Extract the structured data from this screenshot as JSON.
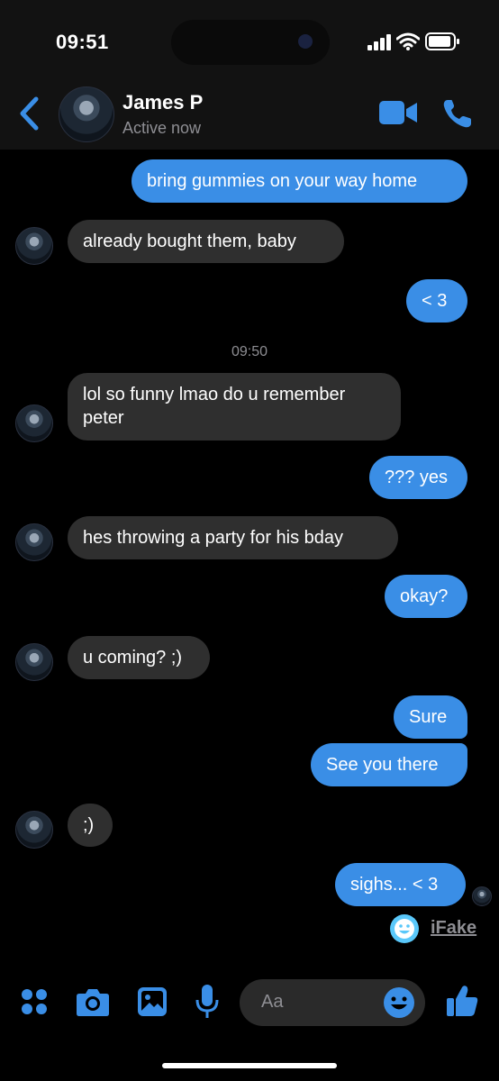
{
  "status_bar": {
    "time": "09:51"
  },
  "header": {
    "name": "James P",
    "status": "Active now"
  },
  "messages": {
    "m1": "bring gummies on your way home",
    "m2": "already bought them, baby",
    "m3": "< 3",
    "timestamp": "09:50",
    "m4_line1": "lol so funny lmao do u remember",
    "m4_line2": "peter",
    "m5": "??? yes",
    "m6": "hes throwing a party for his bday",
    "m7": "okay?",
    "m8": "u coming? ;)",
    "m9": "Sure",
    "m10": "See you there",
    "m11": ";)",
    "m12": "sighs... < 3"
  },
  "watermark": {
    "label": "iFake"
  },
  "composer": {
    "placeholder": "Aa"
  },
  "colors": {
    "accent": "#3a8ee6",
    "outgoing_bubble": "#3a8ee6",
    "incoming_bubble": "#2f2f2f",
    "background": "#000000"
  },
  "icons": [
    "back-chevron-icon",
    "video-call-icon",
    "phone-icon",
    "apps-grid-icon",
    "camera-icon",
    "gallery-icon",
    "microphone-icon",
    "emoji-icon",
    "thumbs-up-icon"
  ]
}
